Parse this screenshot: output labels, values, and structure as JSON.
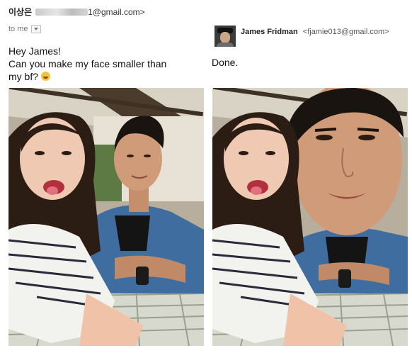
{
  "original_email": {
    "sender_name": "이상은",
    "sender_email_suffix": "1@gmail.com>",
    "to_label": "to me",
    "message_lines": [
      "Hey James!",
      "Can you make my face smaller than",
      "my bf?"
    ]
  },
  "reply_email": {
    "sender_name": "James Fridman",
    "sender_email": "<fjamie013@gmail.com>",
    "message": "Done."
  }
}
